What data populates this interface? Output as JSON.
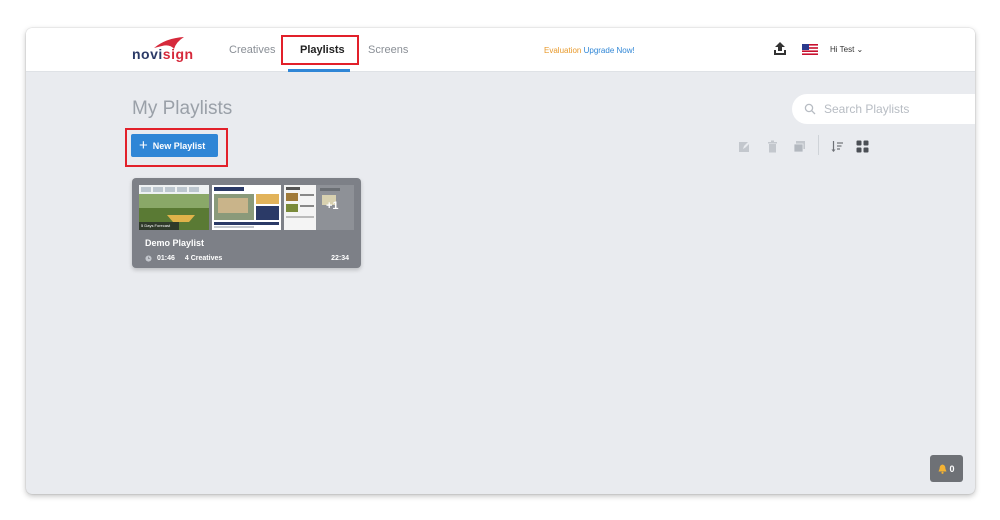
{
  "logo": {
    "text_a": "novi",
    "text_b": "sign"
  },
  "nav": {
    "creatives": "Creatives",
    "playlists": "Playlists",
    "screens": "Screens"
  },
  "evaluation": {
    "label": "Evaluation",
    "upgrade": "Upgrade Now!"
  },
  "user": {
    "greeting": "Hi Test",
    "caret": "⌄"
  },
  "page": {
    "title": "My Playlists"
  },
  "search": {
    "placeholder": "Search Playlists"
  },
  "new_playlist": {
    "plus": "+",
    "label": "New Playlist"
  },
  "playlist": {
    "name": "Demo Playlist",
    "duration": "01:46",
    "creatives": "4 Creatives",
    "time": "22:34",
    "extra_badge": "+1",
    "thumb1_caption": "5 Days Forecast"
  },
  "notifications": {
    "count": "0"
  },
  "colors": {
    "accent": "#2f86d6",
    "highlight": "#e2202a",
    "evaluation": "#e89a2c",
    "card": "#7d8087"
  }
}
